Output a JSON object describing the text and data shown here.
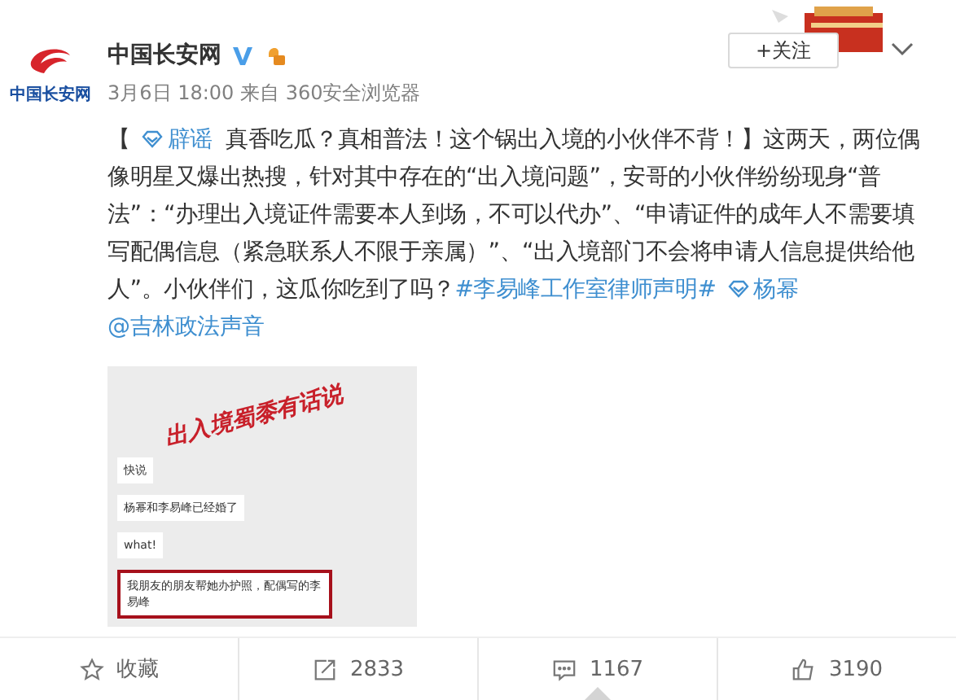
{
  "account": {
    "logo_text": "中国长安网",
    "name": "中国长安网",
    "verified": true,
    "time": "3月6日 18:00",
    "source": "来自 360安全浏览器",
    "follow_label": "+关注"
  },
  "post": {
    "segments": [
      {
        "kind": "text",
        "text": "【 "
      },
      {
        "kind": "tag",
        "text": "辟谣"
      },
      {
        "kind": "text",
        "text": " 真香吃瓜？真相普法！这个锅出入境的小伙伴不背！】这两天，两位偶像明星又爆出热搜，针对其中存在的“出入境问题”，安哥的小伙伴纷纷现身“普法”：“办理出入境证件需要本人到场，不可以代办”、“申请证件的成年人不需要填写配偶信息（紧急联系人不限于亲属）”、“出入境部门不会将申请人信息提供给他人”。小伙伴们，这瓜你吃到了吗？"
      },
      {
        "kind": "topic",
        "text": "#李易峰工作室律师声明#"
      },
      {
        "kind": "tag",
        "text": "杨幂"
      },
      {
        "kind": "mention",
        "text": "@吉林政法声音"
      }
    ]
  },
  "chat_image": {
    "title": "出入境蜀黍有话说",
    "messages": [
      {
        "text": "快说",
        "highlighted": false
      },
      {
        "text": "杨幂和李易峰已经婚了",
        "highlighted": false
      },
      {
        "text": "what!",
        "highlighted": false
      },
      {
        "text": "我朋友的朋友帮她办护照，配偶写的李易峰",
        "highlighted": true
      }
    ]
  },
  "actions": [
    {
      "kind": "star",
      "label": "收藏",
      "selected": false
    },
    {
      "kind": "share",
      "label": "2833",
      "selected": false
    },
    {
      "kind": "comment",
      "label": "1167",
      "selected": true
    },
    {
      "kind": "like",
      "label": "3190",
      "selected": false
    }
  ]
}
